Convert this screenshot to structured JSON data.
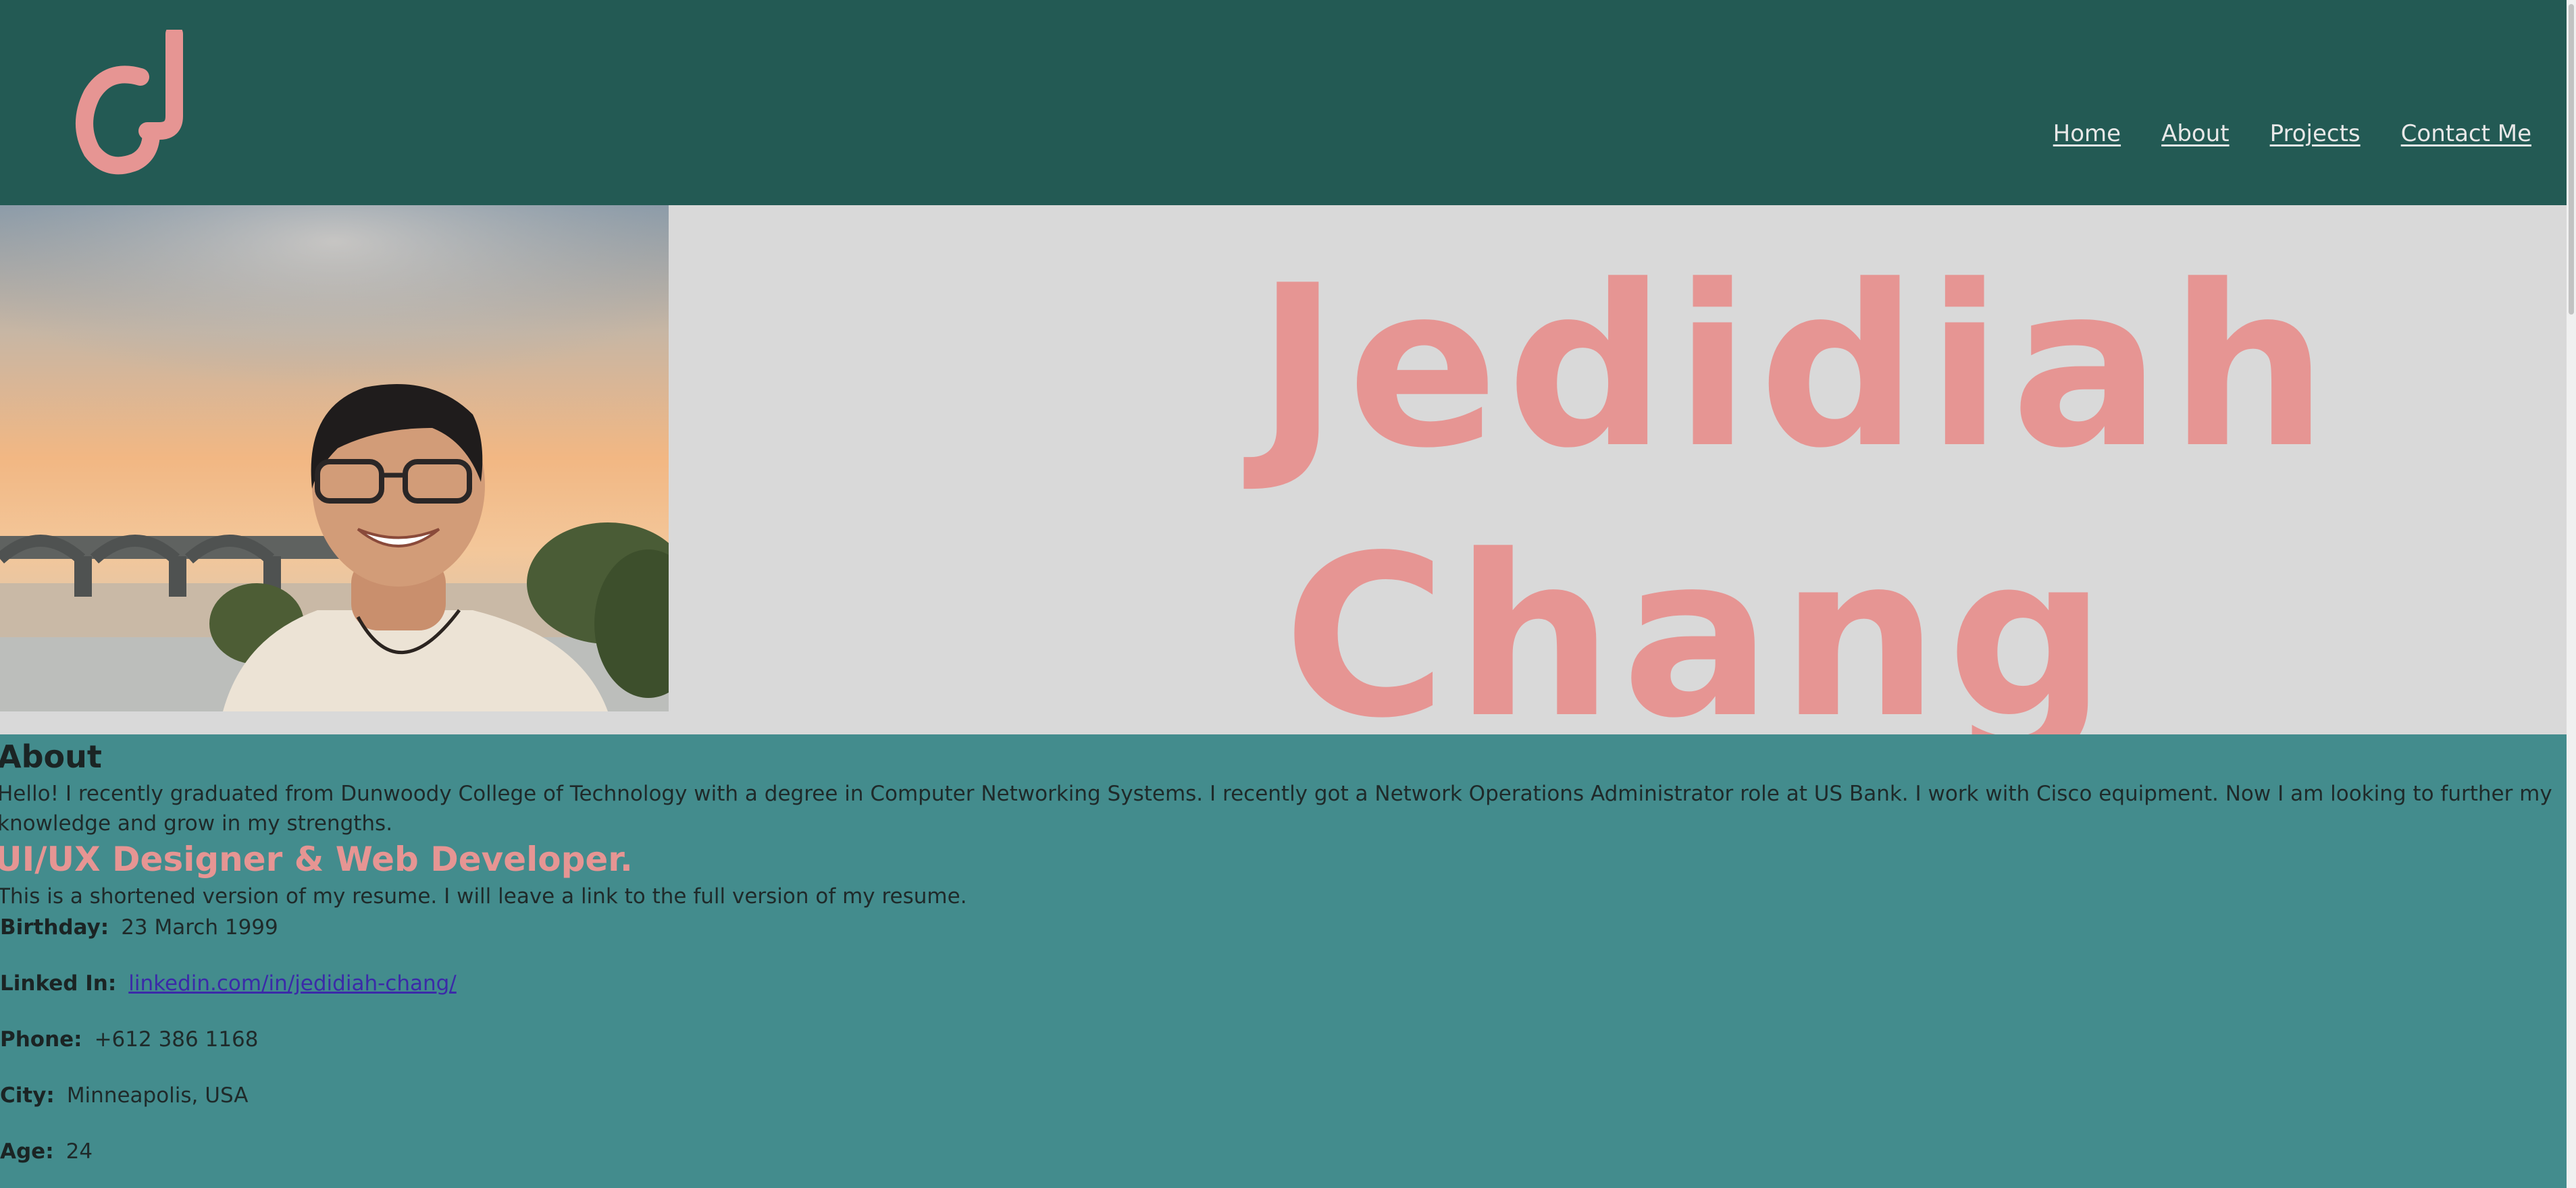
{
  "nav": {
    "items": [
      "Home",
      "About",
      "Projects",
      "Contact Me"
    ]
  },
  "hero": {
    "first_name": "Jedidiah",
    "last_name": "Chang",
    "name_color": "#e69593"
  },
  "about": {
    "heading": "About",
    "intro": "Hello! I recently graduated from Dunwoody College of Technology with a degree in Computer Networking Systems. I recently got a Network Operations Administrator role at US Bank. I work with Cisco equipment. Now I am looking to further my knowledge and grow in my strengths.",
    "role": "UI/UX Designer & Web Developer.",
    "resume_note": "This is a shortened version of my resume. I will leave a link to the full version of my resume.",
    "facts": [
      {
        "label": "Birthday:",
        "value": "23 March 1999"
      },
      {
        "label": "Linked In:",
        "value": "linkedin.com/in/jedidiah-chang/"
      },
      {
        "label": "Phone:",
        "value": "+612 386 1168"
      },
      {
        "label": "City:",
        "value": "Minneapolis, USA"
      },
      {
        "label": "Age:",
        "value": "24"
      }
    ]
  },
  "colors": {
    "header_bg": "#235a54",
    "hero_bg": "#d9d9d9",
    "section_bg": "#438c8d",
    "accent_pink": "#e69593"
  }
}
